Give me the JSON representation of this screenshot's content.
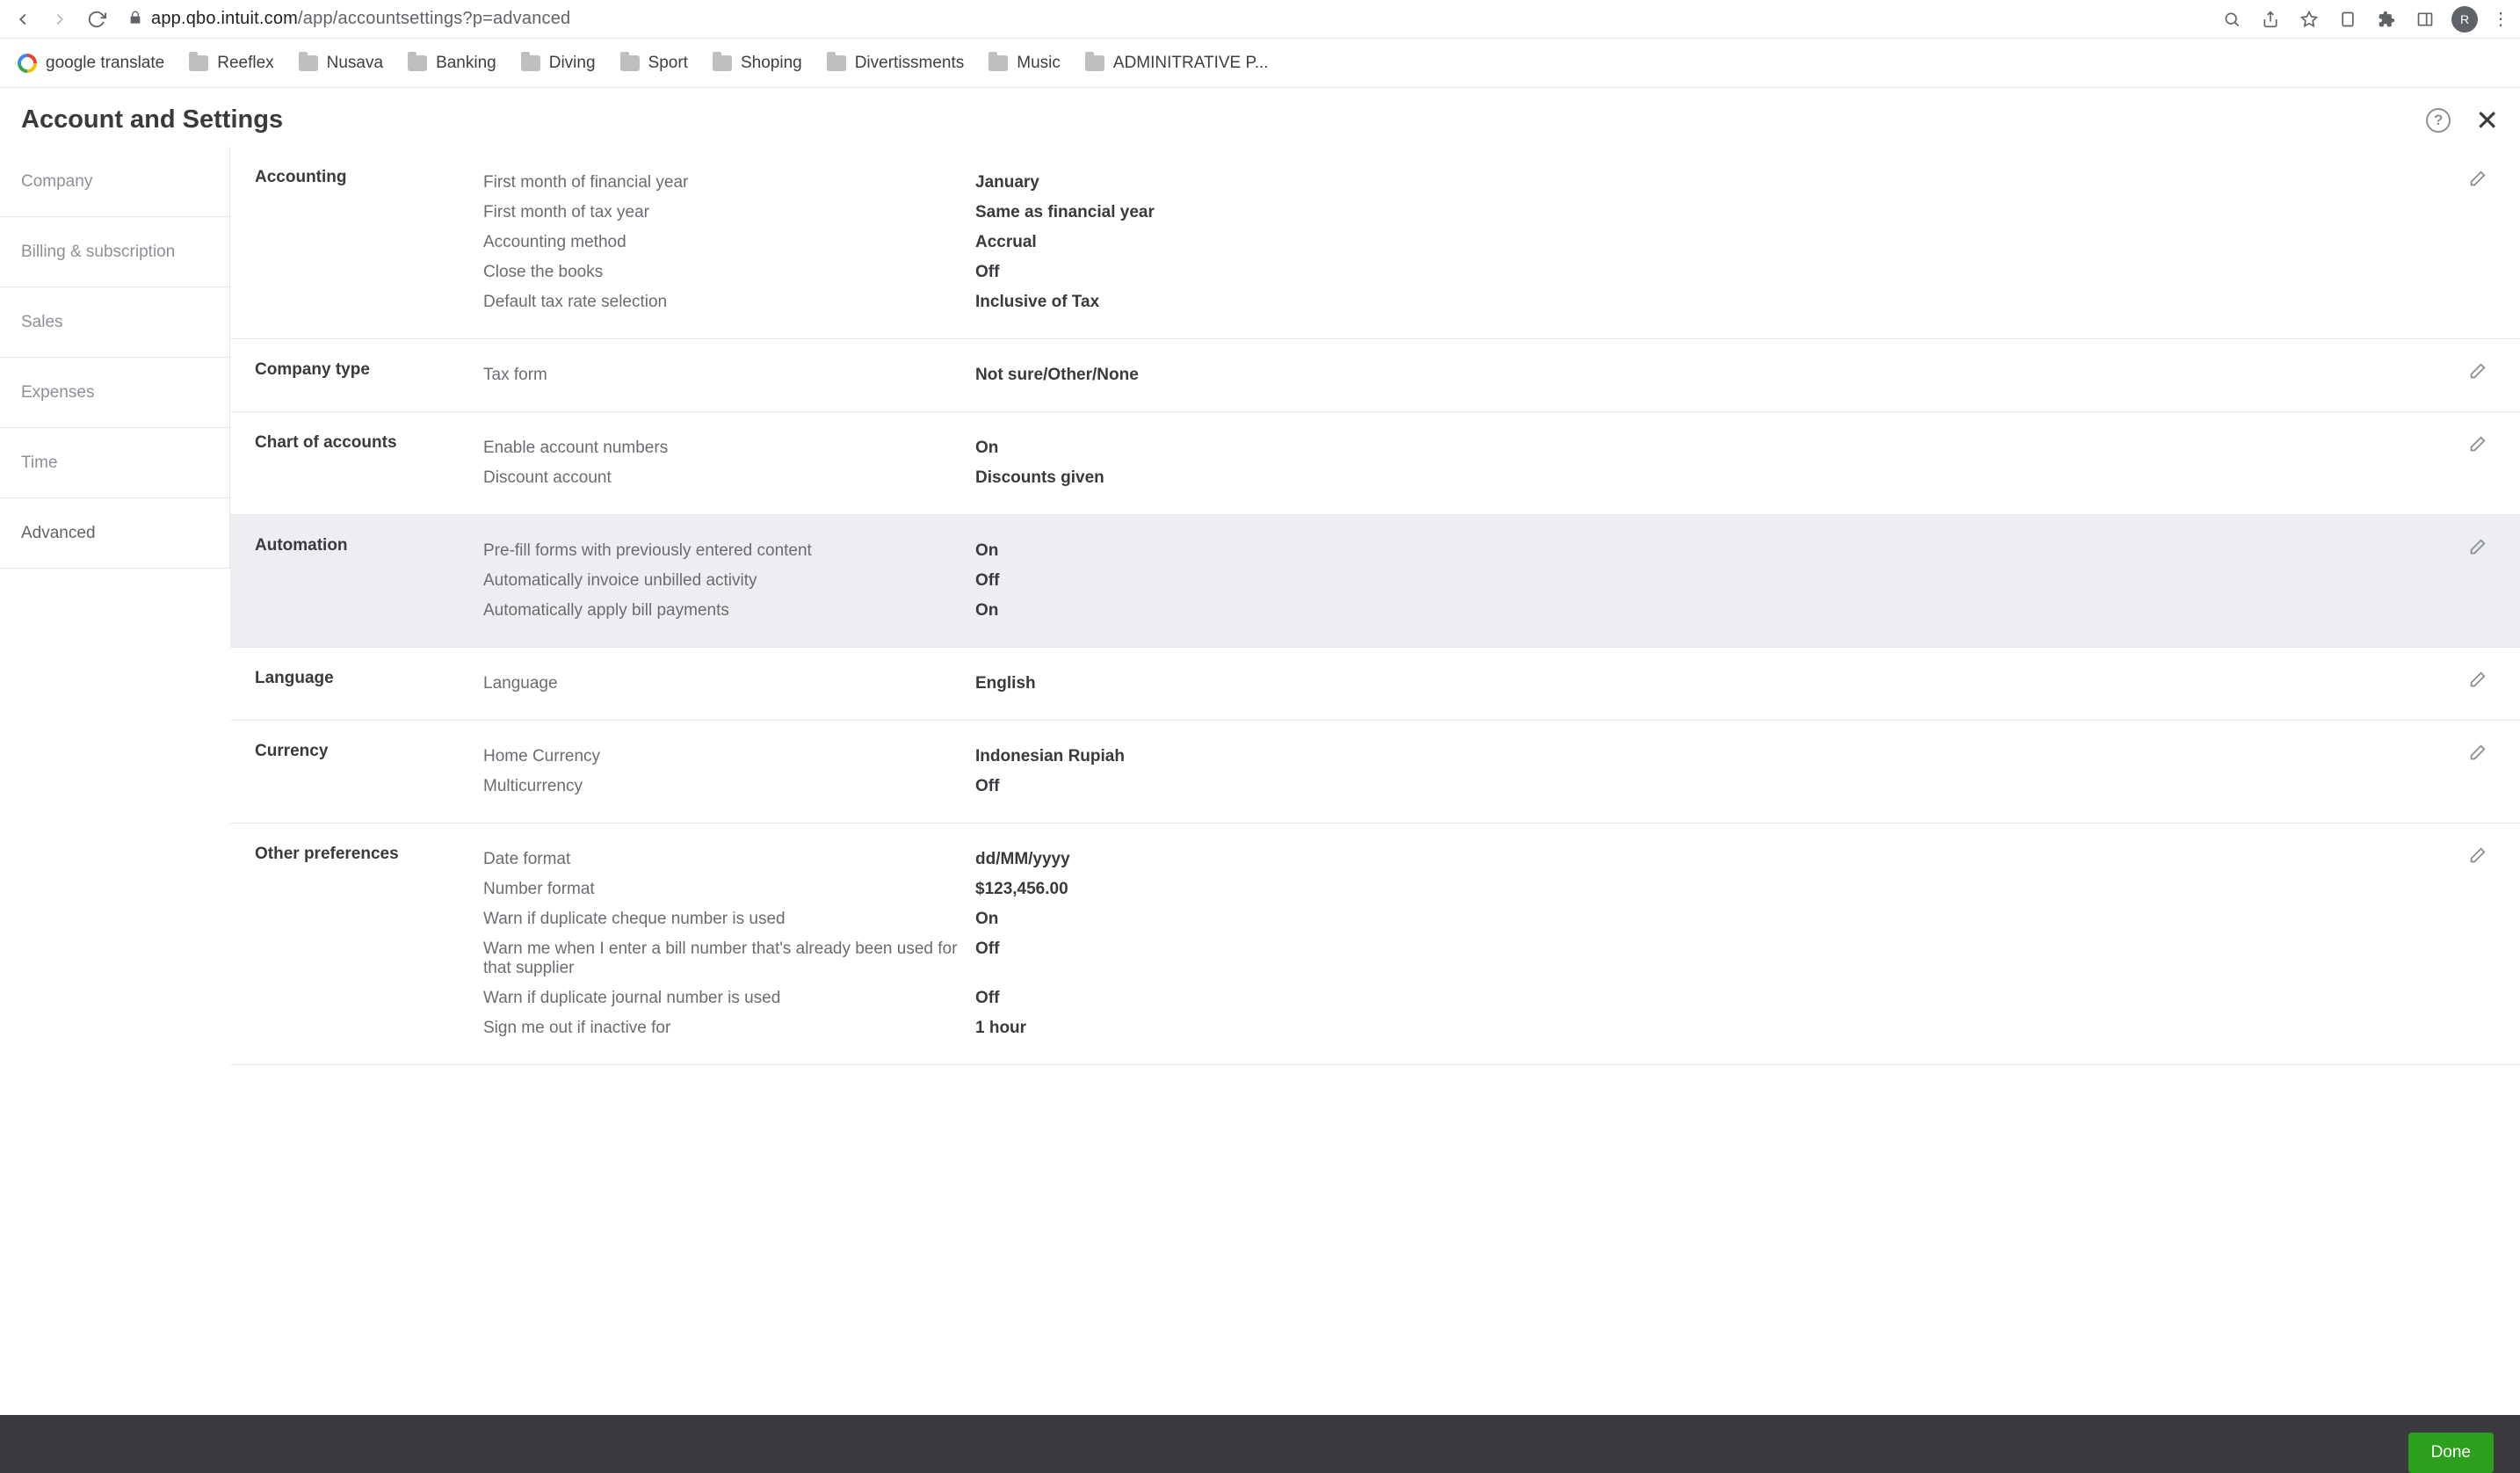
{
  "browser": {
    "url_domain": "app.qbo.intuit.com",
    "url_path": "/app/accountsettings?p=advanced",
    "avatar_letter": "R"
  },
  "bookmarks": [
    {
      "icon": "google",
      "label": "google translate"
    },
    {
      "icon": "folder",
      "label": "Reeflex"
    },
    {
      "icon": "folder",
      "label": "Nusava"
    },
    {
      "icon": "folder",
      "label": "Banking"
    },
    {
      "icon": "folder",
      "label": "Diving"
    },
    {
      "icon": "folder",
      "label": "Sport"
    },
    {
      "icon": "folder",
      "label": "Shoping"
    },
    {
      "icon": "folder",
      "label": "Divertissments"
    },
    {
      "icon": "folder",
      "label": "Music"
    },
    {
      "icon": "folder",
      "label": "ADMINITRATIVE P..."
    }
  ],
  "header": {
    "title": "Account and Settings"
  },
  "side_nav": [
    {
      "label": "Company",
      "active": false
    },
    {
      "label": "Billing & subscription",
      "active": false
    },
    {
      "label": "Sales",
      "active": false
    },
    {
      "label": "Expenses",
      "active": false
    },
    {
      "label": "Time",
      "active": false
    },
    {
      "label": "Advanced",
      "active": true
    }
  ],
  "sections": [
    {
      "title": "Accounting",
      "highlight": false,
      "rows": [
        {
          "label": "First month of financial year",
          "value": "January"
        },
        {
          "label": "First month of tax year",
          "value": "Same as financial year"
        },
        {
          "label": "Accounting method",
          "value": "Accrual"
        },
        {
          "label": "Close the books",
          "value": "Off"
        },
        {
          "label": "Default tax rate selection",
          "value": "Inclusive of Tax"
        }
      ]
    },
    {
      "title": "Company type",
      "highlight": false,
      "rows": [
        {
          "label": "Tax form",
          "value": "Not sure/Other/None"
        }
      ]
    },
    {
      "title": "Chart of accounts",
      "highlight": false,
      "rows": [
        {
          "label": "Enable account numbers",
          "value": "On"
        },
        {
          "label": "Discount account",
          "value": "Discounts given"
        }
      ]
    },
    {
      "title": "Automation",
      "highlight": true,
      "rows": [
        {
          "label": "Pre-fill forms with previously entered content",
          "value": "On"
        },
        {
          "label": "Automatically invoice unbilled activity",
          "value": "Off"
        },
        {
          "label": "Automatically apply bill payments",
          "value": "On"
        }
      ]
    },
    {
      "title": "Language",
      "highlight": false,
      "rows": [
        {
          "label": "Language",
          "value": "English"
        }
      ]
    },
    {
      "title": "Currency",
      "highlight": false,
      "rows": [
        {
          "label": "Home Currency",
          "value": "Indonesian Rupiah"
        },
        {
          "label": "Multicurrency",
          "value": "Off"
        }
      ]
    },
    {
      "title": "Other preferences",
      "highlight": false,
      "rows": [
        {
          "label": "Date format",
          "value": "dd/MM/yyyy"
        },
        {
          "label": "Number format",
          "value": "$123,456.00"
        },
        {
          "label": "Warn if duplicate cheque number is used",
          "value": "On"
        },
        {
          "label": "Warn me when I enter a bill number that's already been used for that supplier",
          "value": "Off"
        },
        {
          "label": "Warn if duplicate journal number is used",
          "value": "Off"
        },
        {
          "label": "Sign me out if inactive for",
          "value": "1 hour"
        }
      ]
    }
  ],
  "footer": {
    "done_label": "Done"
  }
}
